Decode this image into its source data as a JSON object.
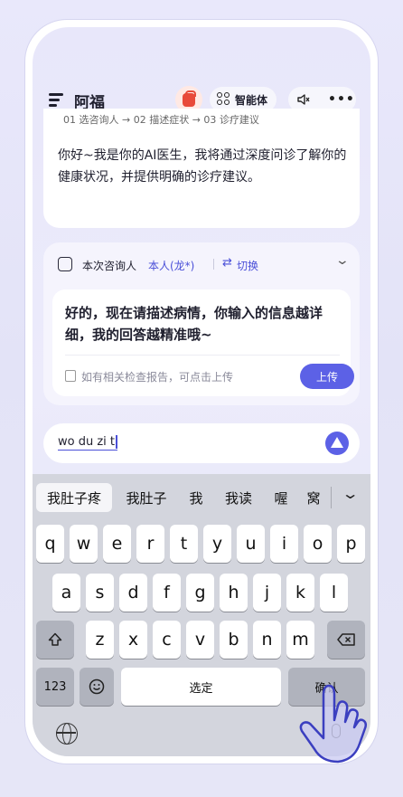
{
  "header": {
    "app_title": "阿福",
    "agent_label": "智能体"
  },
  "intro": {
    "steps": "01 选咨询人  →  02 描述症状  →  03 诊疗建议",
    "message": "你好~我是你的AI医生，我将通过深度问诊了解你的健康状况，并提供明确的诊疗建议。"
  },
  "consult": {
    "label": "本次咨询人",
    "person": "本人(龙*)",
    "switch_label": "切换",
    "message": "好的，现在请描述病情，你输入的信息越详细，我的回答越精准哦~",
    "report_hint": "如有相关检查报告，可点击上传",
    "upload_label": "上传"
  },
  "input": {
    "value": "wo du zi t"
  },
  "keyboard": {
    "candidates": [
      "我肚子疼",
      "我肚子",
      "我",
      "我读",
      "喔",
      "窝"
    ],
    "row1": [
      "q",
      "w",
      "e",
      "r",
      "t",
      "y",
      "u",
      "i",
      "o",
      "p"
    ],
    "row2": [
      "a",
      "s",
      "d",
      "f",
      "g",
      "h",
      "j",
      "k",
      "l"
    ],
    "row3": [
      "z",
      "x",
      "c",
      "v",
      "b",
      "n",
      "m"
    ],
    "num_label": "123",
    "space_label": "选定",
    "confirm_label": "确认"
  },
  "colors": {
    "accent": "#5c61e6",
    "link": "#4a4fd8"
  }
}
